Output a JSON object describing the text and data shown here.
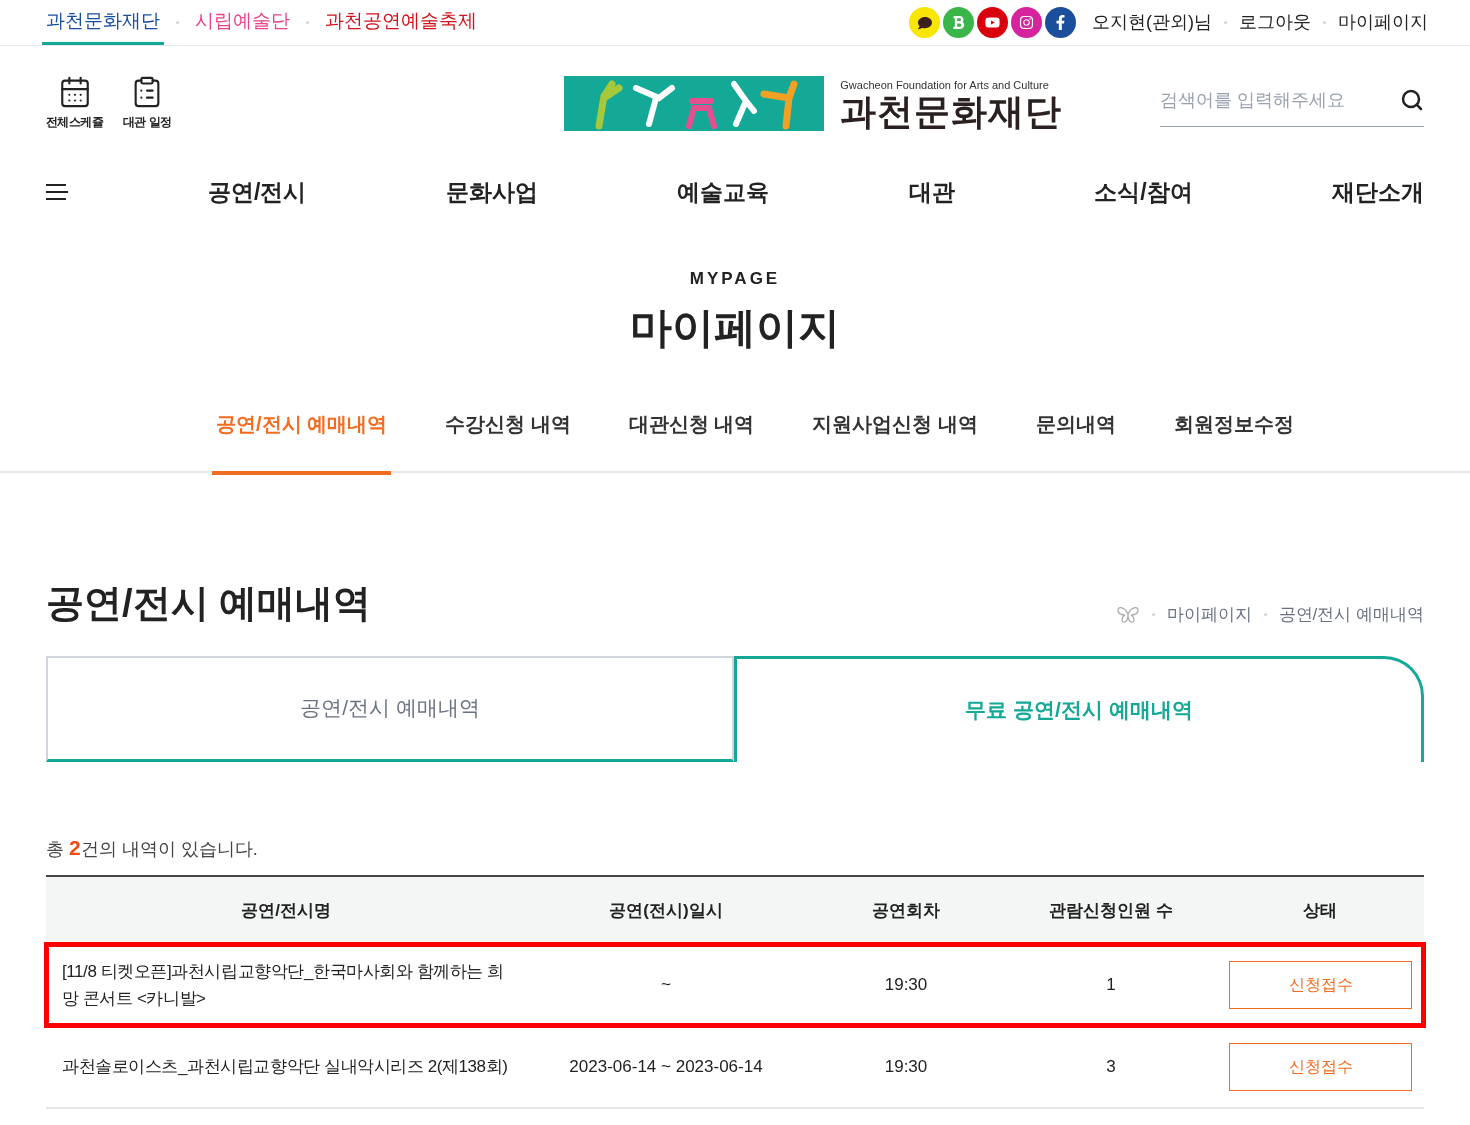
{
  "top_bar": {
    "sites": [
      {
        "label": "과천문화재단",
        "selected": true,
        "color": "#1a4fa0"
      },
      {
        "label": "시립예술단",
        "selected": false,
        "color": "#e8458b"
      },
      {
        "label": "과천공연예술축제",
        "selected": false,
        "color": "#d0121b"
      }
    ],
    "social": [
      {
        "kind": "kakao",
        "color": "#f7e600"
      },
      {
        "kind": "blog",
        "color": "#3ab54a"
      },
      {
        "kind": "youtube",
        "color": "#d9000d"
      },
      {
        "kind": "instagram",
        "color": "#d6249f"
      },
      {
        "kind": "facebook",
        "color": "#1b4f9c"
      }
    ],
    "user_links": [
      "오지현(관외)님",
      "로그아웃",
      "마이페이지"
    ]
  },
  "header": {
    "quick_links": [
      {
        "kind": "calendar",
        "label": "전체스케쥴"
      },
      {
        "kind": "clipboard",
        "label": "대관 일정"
      }
    ],
    "logo": {
      "subtitle": "Gwacheon Foundation for Arts and Culture",
      "name": "과천문화재단"
    },
    "search": {
      "placeholder": "검색어를 입력해주세요"
    }
  },
  "nav": [
    "공연/전시",
    "문화사업",
    "예술교육",
    "대관",
    "소식/참여",
    "재단소개"
  ],
  "page_heading": {
    "eyebrow": "MYPAGE",
    "title": "마이페이지"
  },
  "mypage_tabs": [
    {
      "label": "공연/전시 예매내역",
      "selected": true
    },
    {
      "label": "수강신청 내역",
      "selected": false
    },
    {
      "label": "대관신청 내역",
      "selected": false
    },
    {
      "label": "지원사업신청 내역",
      "selected": false
    },
    {
      "label": "문의내역",
      "selected": false
    },
    {
      "label": "회원정보수정",
      "selected": false
    }
  ],
  "section": {
    "title": "공연/전시 예매내역",
    "breadcrumb": [
      "마이페이지",
      "공연/전시 예매내역"
    ]
  },
  "sub_tabs": [
    {
      "label": "공연/전시 예매내역",
      "selected": false
    },
    {
      "label": "무료 공연/전시 예매내역",
      "selected": true
    }
  ],
  "summary": {
    "prefix": "총",
    "count": "2",
    "suffix": "건의 내역이 있습니다."
  },
  "table": {
    "columns": [
      "공연/전시명",
      "공연(전시)일시",
      "공연회차",
      "관람신청인원 수",
      "상태"
    ],
    "rows": [
      {
        "title": "[11/8 티켓오픈]과천시립교향악단_한국마사회와 함께하는 희망 콘서트 <카니발>",
        "date": "~",
        "session": "19:30",
        "count": "1",
        "status": "신청접수",
        "highlighted": true
      },
      {
        "title": "과천솔로이스츠_과천시립교향악단 실내악시리즈 2(제138회)",
        "date": "2023-06-14 ~ 2023-06-14",
        "session": "19:30",
        "count": "3",
        "status": "신청접수",
        "highlighted": false
      }
    ]
  }
}
